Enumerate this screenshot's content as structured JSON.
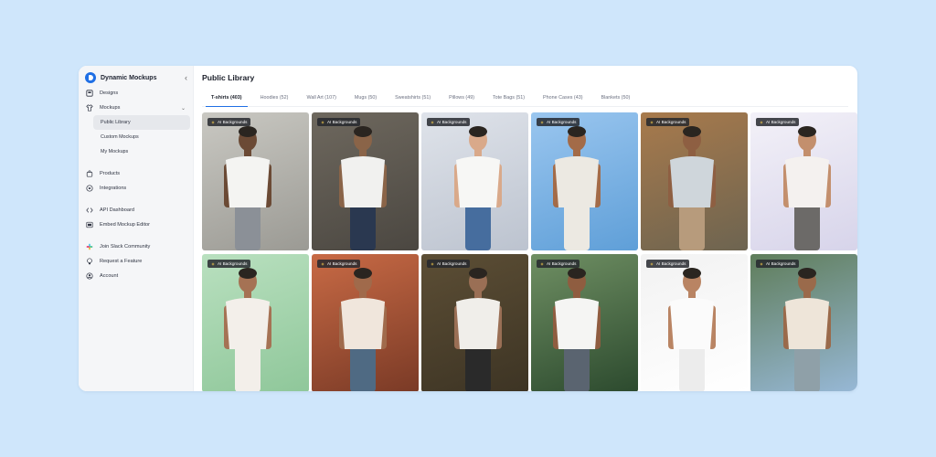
{
  "app": {
    "name": "Dynamic Mockups",
    "collapse_glyph": "‹"
  },
  "sidebar": {
    "items": [
      {
        "id": "designs",
        "label": "Designs",
        "icon": "designs-icon"
      },
      {
        "id": "mockups",
        "label": "Mockups",
        "icon": "shirt-icon",
        "expanded": true,
        "chevron": "⌄"
      }
    ],
    "sub_items": [
      {
        "label": "Public Library",
        "active": true
      },
      {
        "label": "Custom Mockups",
        "active": false
      },
      {
        "label": "My Mockups",
        "active": false
      }
    ],
    "items2": [
      {
        "label": "Products",
        "icon": "bag-icon"
      },
      {
        "label": "Integrations",
        "icon": "plug-icon"
      }
    ],
    "items3": [
      {
        "label": "API Dashboard",
        "icon": "code-icon"
      },
      {
        "label": "Embed Mockup Editor",
        "icon": "embed-icon"
      }
    ],
    "items4": [
      {
        "label": "Join Slack Community",
        "icon": "slack-icon"
      },
      {
        "label": "Request a Feature",
        "icon": "lightbulb-icon"
      },
      {
        "label": "Account",
        "icon": "account-icon"
      }
    ]
  },
  "main": {
    "title": "Public Library",
    "tabs": [
      {
        "label": "T-shirts (403)",
        "active": true
      },
      {
        "label": "Hoodies (52)",
        "active": false
      },
      {
        "label": "Wall Art (107)",
        "active": false
      },
      {
        "label": "Mugs (50)",
        "active": false
      },
      {
        "label": "Sweatshirts (51)",
        "active": false
      },
      {
        "label": "Pillows (49)",
        "active": false
      },
      {
        "label": "Tote Bags (51)",
        "active": false
      },
      {
        "label": "Phone Cases (43)",
        "active": false
      },
      {
        "label": "Blankets (50)",
        "active": false
      }
    ],
    "badge_label": "AI Backgrounds",
    "cards": [
      {
        "bg": "#9b9a94",
        "bg2": "#c9c8c2",
        "shirt": "#f4f4f2",
        "skin": "#6b4a35",
        "pants": "#8b9097"
      },
      {
        "bg": "#4b4741",
        "bg2": "#6e685e",
        "shirt": "#f1f1ef",
        "skin": "#8a6448",
        "pants": "#2a3850"
      },
      {
        "bg": "#bcc3cf",
        "bg2": "#dfe3ea",
        "shirt": "#f7f7f5",
        "skin": "#d9a98a",
        "pants": "#466d9e"
      },
      {
        "bg": "#5f9fd8",
        "bg2": "#9ac6ef",
        "shirt": "#ece9e2",
        "skin": "#a36b48",
        "pants": "#ece9e2"
      },
      {
        "bg": "#6d6450",
        "bg2": "#a87a4c",
        "shirt": "#cfd6db",
        "skin": "#8e5f42",
        "pants": "#b79b7c"
      },
      {
        "bg": "#d7d4ea",
        "bg2": "#f3f1f8",
        "shirt": "#f4f1ef",
        "skin": "#c38f6d",
        "pants": "#6c6a68"
      },
      {
        "bg": "#8fc79a",
        "bg2": "#b9e0bf",
        "shirt": "#f3efea",
        "skin": "#a57254",
        "pants": "#f3efea"
      },
      {
        "bg": "#7a3a26",
        "bg2": "#c86a45",
        "shirt": "#f0e6dc",
        "skin": "#a06a4b",
        "pants": "#4f6a83"
      },
      {
        "bg": "#3d3424",
        "bg2": "#5c4e35",
        "shirt": "#f0eeea",
        "skin": "#9a6f55",
        "pants": "#2a2a2a"
      },
      {
        "bg": "#2c4a2e",
        "bg2": "#6f8f63",
        "shirt": "#f5f5f3",
        "skin": "#8f5d40",
        "pants": "#5a6470"
      },
      {
        "bg": "#ffffff",
        "bg2": "#f2f2f2",
        "shirt": "#fbfbfb",
        "skin": "#b98463",
        "pants": "#ececec"
      },
      {
        "bg": "#97b8d6",
        "bg2": "#5f7d5a",
        "shirt": "#eee5d9",
        "skin": "#9a6a4b",
        "pants": "#8fa0a8"
      }
    ]
  },
  "colors": {
    "accent": "#1f6fe5",
    "page_bg": "#cfe6fb"
  }
}
